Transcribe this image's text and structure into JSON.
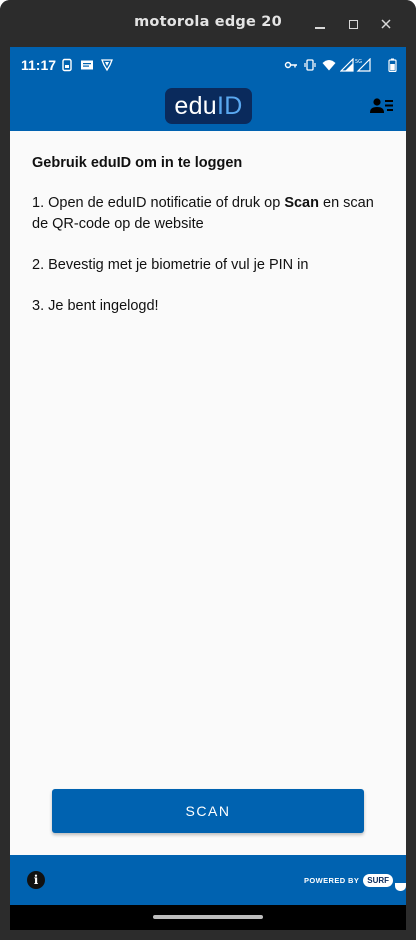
{
  "window": {
    "title": "motorola edge 20"
  },
  "statusbar": {
    "time": "11:17"
  },
  "appbar": {
    "logo_part1": "edu",
    "logo_part2": "ID",
    "profile_icon": "person-list-icon"
  },
  "content": {
    "heading": "Gebruik eduID om in te loggen",
    "step1_prefix": "1. Open de eduID notificatie of druk op ",
    "step1_bold": "Scan",
    "step1_suffix": " en scan de QR-code op de website",
    "step2": "2. Bevestig met je biometrie of vul je PIN in",
    "step3": "3. Je bent ingelogd!"
  },
  "scan_button": {
    "label": "SCAN"
  },
  "footer": {
    "powered_by": "POWERED BY",
    "brand": "SURF",
    "info_icon": "info-icon"
  },
  "colors": {
    "primary": "#0062b0",
    "logo_bg": "#0a2a5c",
    "logo_accent": "#5aa8f0",
    "title_bar": "#2c2c2c"
  }
}
